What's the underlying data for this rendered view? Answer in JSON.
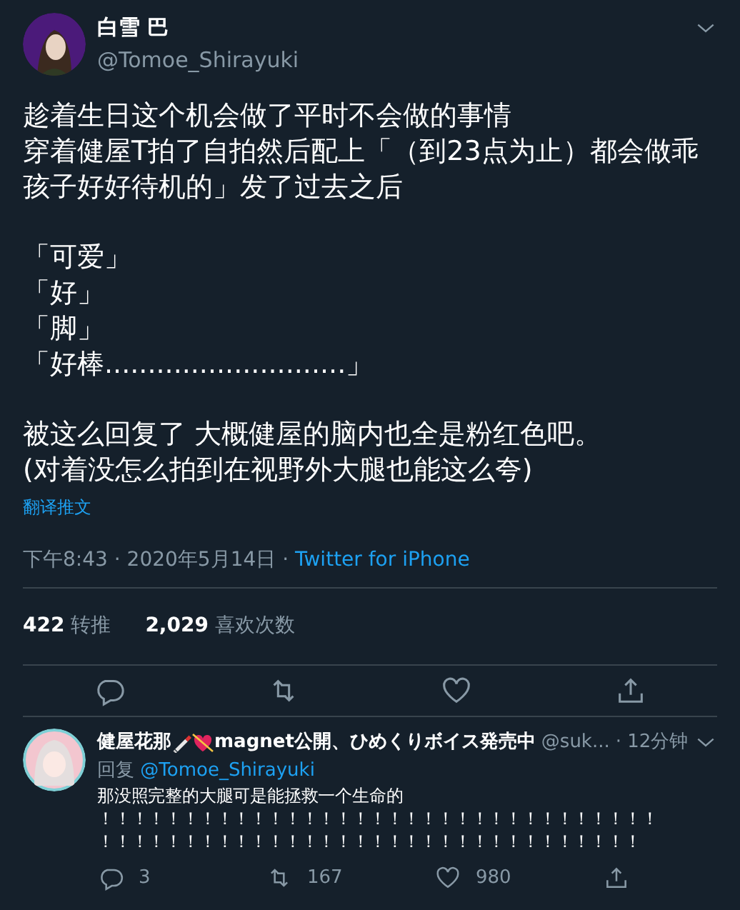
{
  "tweet": {
    "name": "白雪 巴",
    "handle": "@Tomoe_Shirayuki",
    "paragraphs": [
      [
        "趁着生日这个机会做了平时不会做的事情",
        "穿着健屋T拍了自拍然后配上「（到23点为止）都会做乖孩子好好待机的」发了过去之后"
      ],
      [
        "「可爱」",
        "「好」",
        "「脚」",
        "「好棒............................」"
      ],
      [
        "被这么回复了 大概健屋的脑内也全是粉红色吧。",
        "(对着没怎么拍到在视野外大腿也能这么夸)"
      ]
    ],
    "translate": "翻译推文",
    "time": "下午8:43 · 2020年5月14日",
    "separator": " · ",
    "source": "Twitter for iPhone",
    "stats": [
      {
        "count": "422",
        "label": "转推"
      },
      {
        "count": "2,029",
        "label": "喜欢次数"
      }
    ]
  },
  "reply": {
    "name_before": "健屋花那",
    "name_after": "magnet公開、ひめくりボイス発売中",
    "handle": "@suk...",
    "time": "· 12分钟",
    "reply_label": "回复",
    "reply_to": "@Tomoe_Shirayuki",
    "lines": [
      "那没照完整的大腿可是能拯救一个生命的",
      "！！！！！！！！！！！！！！！！！！！！！！！！！！！！！！！！！",
      "！！！！！！！！！！！！！！！！！！！！！！！！！！！！！！！！"
    ],
    "actions": [
      {
        "kind": "reply",
        "count": "3"
      },
      {
        "kind": "retweet",
        "count": "167"
      },
      {
        "kind": "like",
        "count": "980"
      },
      {
        "kind": "share"
      }
    ]
  }
}
